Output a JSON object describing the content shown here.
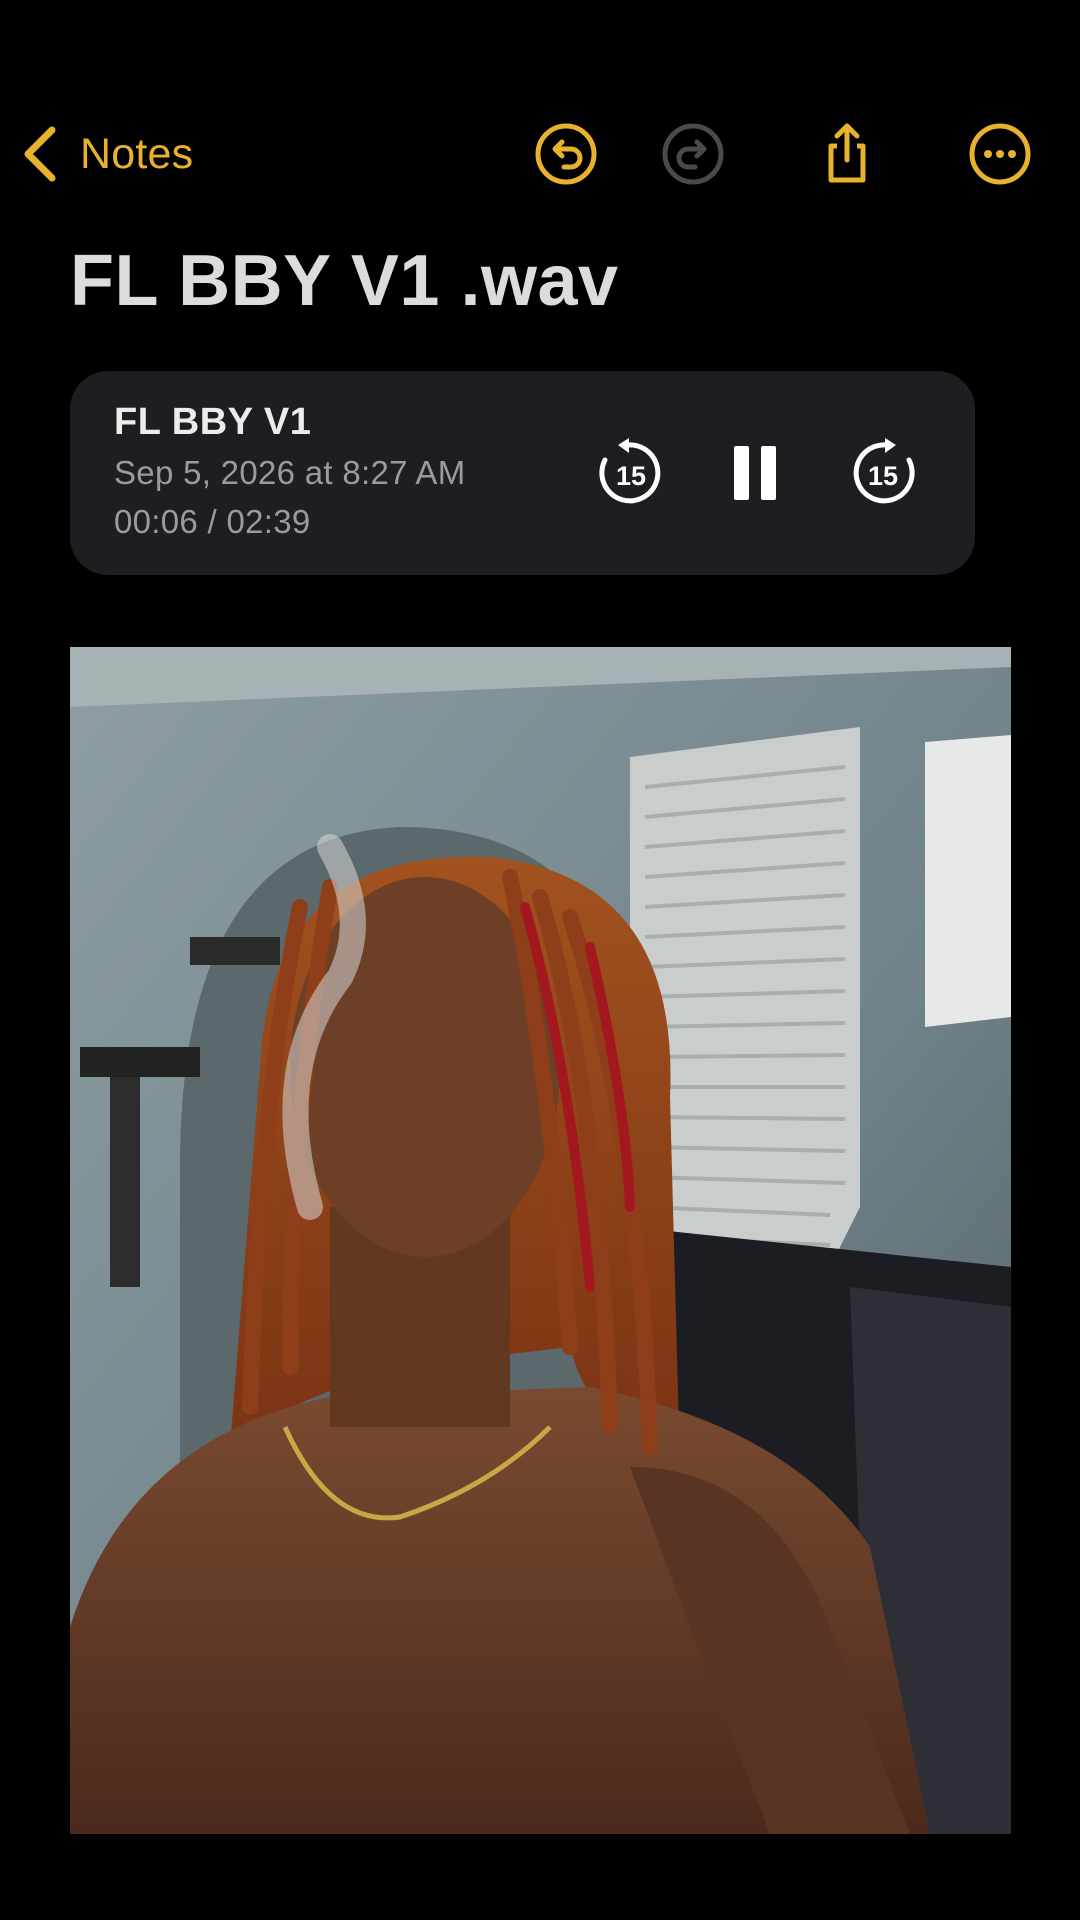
{
  "nav": {
    "back_label": "Notes",
    "icons": [
      "chevron-left-icon",
      "undo-icon",
      "redo-icon",
      "share-icon",
      "more-icon"
    ],
    "accent_color": "#e8b22c",
    "disabled_color": "#4a4a4e"
  },
  "note": {
    "title": "FL BBY V1 .wav"
  },
  "audio": {
    "name": "FL BBY V1",
    "date": "Sep 5, 2026 at 8:27 AM",
    "time": "00:06 / 02:39",
    "skip_back_label": "15",
    "skip_forward_label": "15",
    "state": "playing",
    "card_color": "#1e1e22"
  },
  "attachment": {
    "type": "photo"
  }
}
